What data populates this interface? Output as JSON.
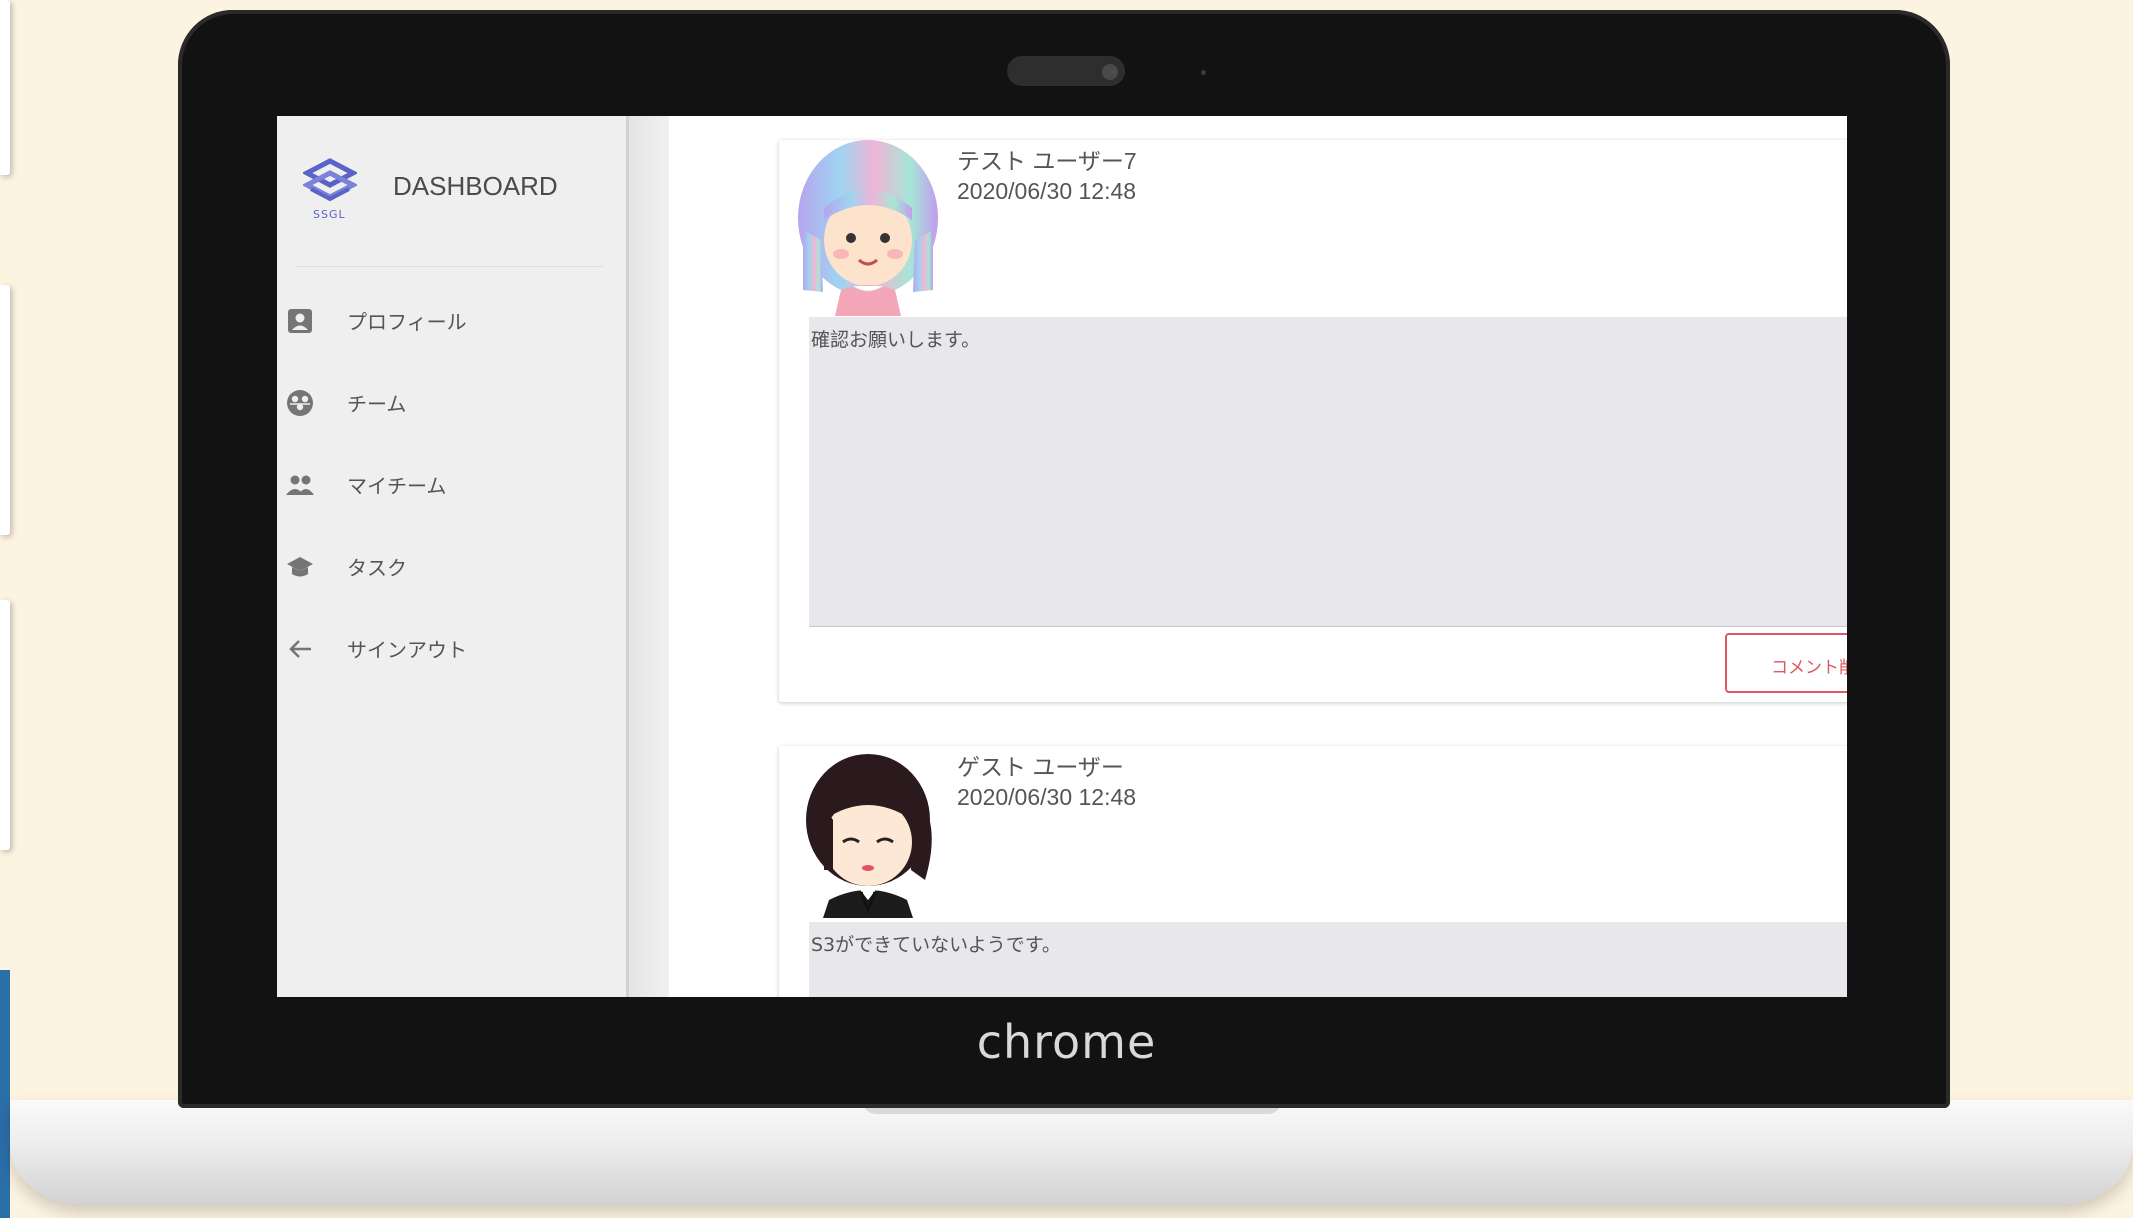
{
  "device": {
    "brand": "chrome"
  },
  "sidebar": {
    "logo_text": "SSGL",
    "title": "DASHBOARD",
    "items": [
      {
        "label": "プロフィール",
        "icon": "profile-icon"
      },
      {
        "label": "チーム",
        "icon": "team-icon"
      },
      {
        "label": "マイチーム",
        "icon": "people-icon"
      },
      {
        "label": "タスク",
        "icon": "graduation-cap-icon"
      },
      {
        "label": "サインアウト",
        "icon": "arrow-left-icon"
      }
    ]
  },
  "posts": [
    {
      "user": "テスト ユーザー7",
      "date": "2020/06/30 12:48",
      "comment": "確認お願いします。",
      "button_label": "コメント削除"
    },
    {
      "user": "ゲスト ユーザー",
      "date": "2020/06/30 12:48",
      "comment": "S3ができていないようです。"
    }
  ],
  "colors": {
    "accent": "#e05560",
    "logo": "#5a63c8",
    "sidebar_bg": "#efefef",
    "comment_bg": "#e8e8ec"
  }
}
